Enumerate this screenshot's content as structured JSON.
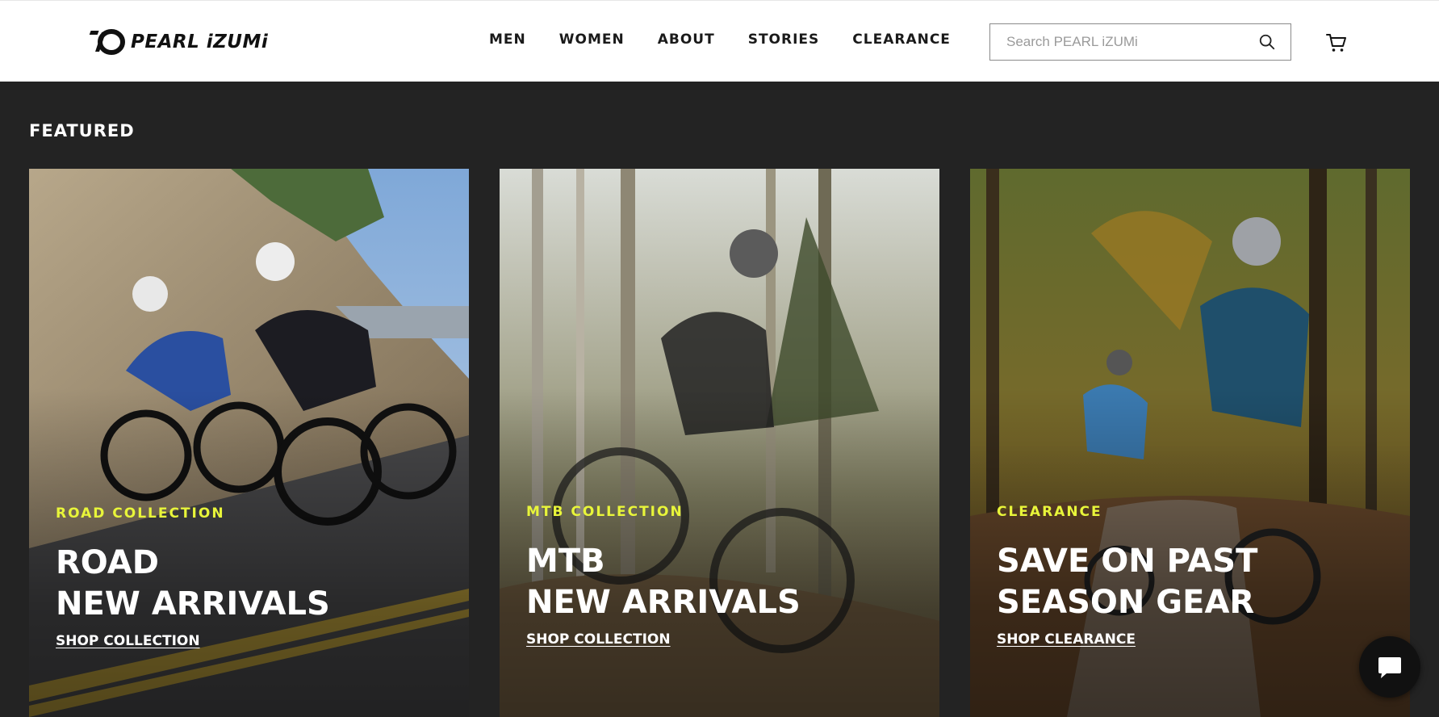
{
  "header": {
    "logo_text": "PEARL iZUMi",
    "nav": [
      {
        "label": "MEN"
      },
      {
        "label": "WOMEN"
      },
      {
        "label": "ABOUT"
      },
      {
        "label": "STORIES"
      },
      {
        "label": "CLEARANCE"
      }
    ],
    "search": {
      "placeholder": "Search PEARL iZUMi",
      "icon": "search-icon"
    },
    "cart_icon": "cart-icon"
  },
  "featured": {
    "title": "FEATURED",
    "cards": [
      {
        "eyebrow": "ROAD COLLECTION",
        "title": "ROAD\nNEW ARRIVALS",
        "link": "SHOP COLLECTION"
      },
      {
        "eyebrow": "MTB COLLECTION",
        "title": "MTB\nNEW ARRIVALS",
        "link": "SHOP COLLECTION"
      },
      {
        "eyebrow": "CLEARANCE",
        "title": "SAVE ON PAST\nSEASON GEAR",
        "link": "SHOP CLEARANCE"
      }
    ]
  },
  "colors": {
    "accent_yellow": "#e8f53a",
    "page_background": "#232323",
    "header_background": "#ffffff"
  },
  "chat": {
    "icon": "chat-bubble-icon"
  }
}
